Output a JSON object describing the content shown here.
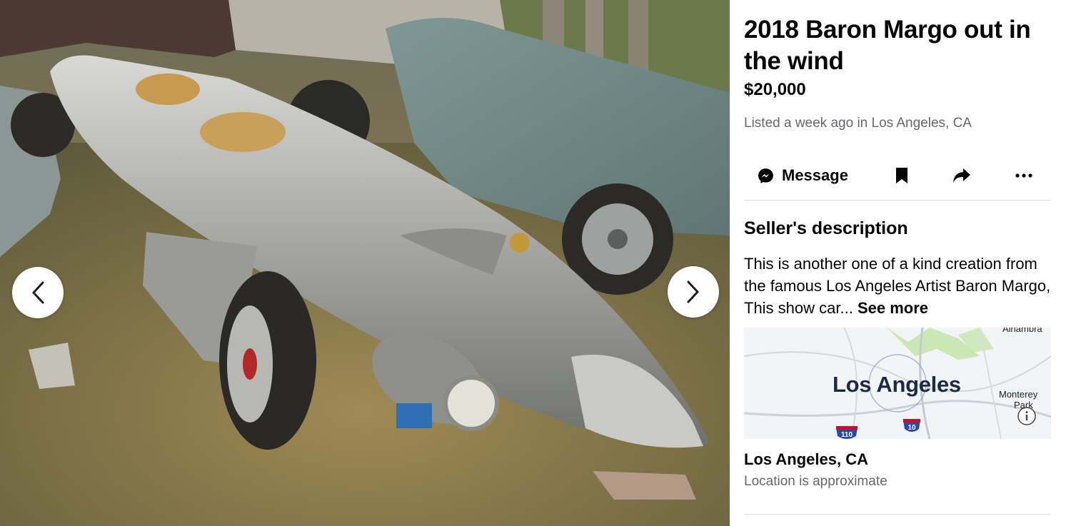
{
  "listing": {
    "title": "2018 Baron Margo out in the wind",
    "price": "$20,000",
    "listed": "Listed a week ago in Los Angeles, CA"
  },
  "actions": {
    "message_label": "Message",
    "icons": [
      "messenger-icon",
      "bookmark-icon",
      "share-icon",
      "more-icon"
    ]
  },
  "description": {
    "heading": "Seller's description",
    "text": "This is another one of a kind creation from the famous Los Angeles Artist Baron Margo, This show car... ",
    "see_more": "See more"
  },
  "map": {
    "city_label": "Los Angeles",
    "nearby_label_1": "Monterey",
    "nearby_label_2": "Park",
    "nearby_label_top": "Alhambra",
    "highway_1": "110",
    "highway_2": "10"
  },
  "location": {
    "name": "Los Angeles, CA",
    "note": "Location is approximate"
  },
  "colors": {
    "text_primary": "#050505",
    "text_secondary": "#65676b",
    "divider": "#dcdee3"
  }
}
